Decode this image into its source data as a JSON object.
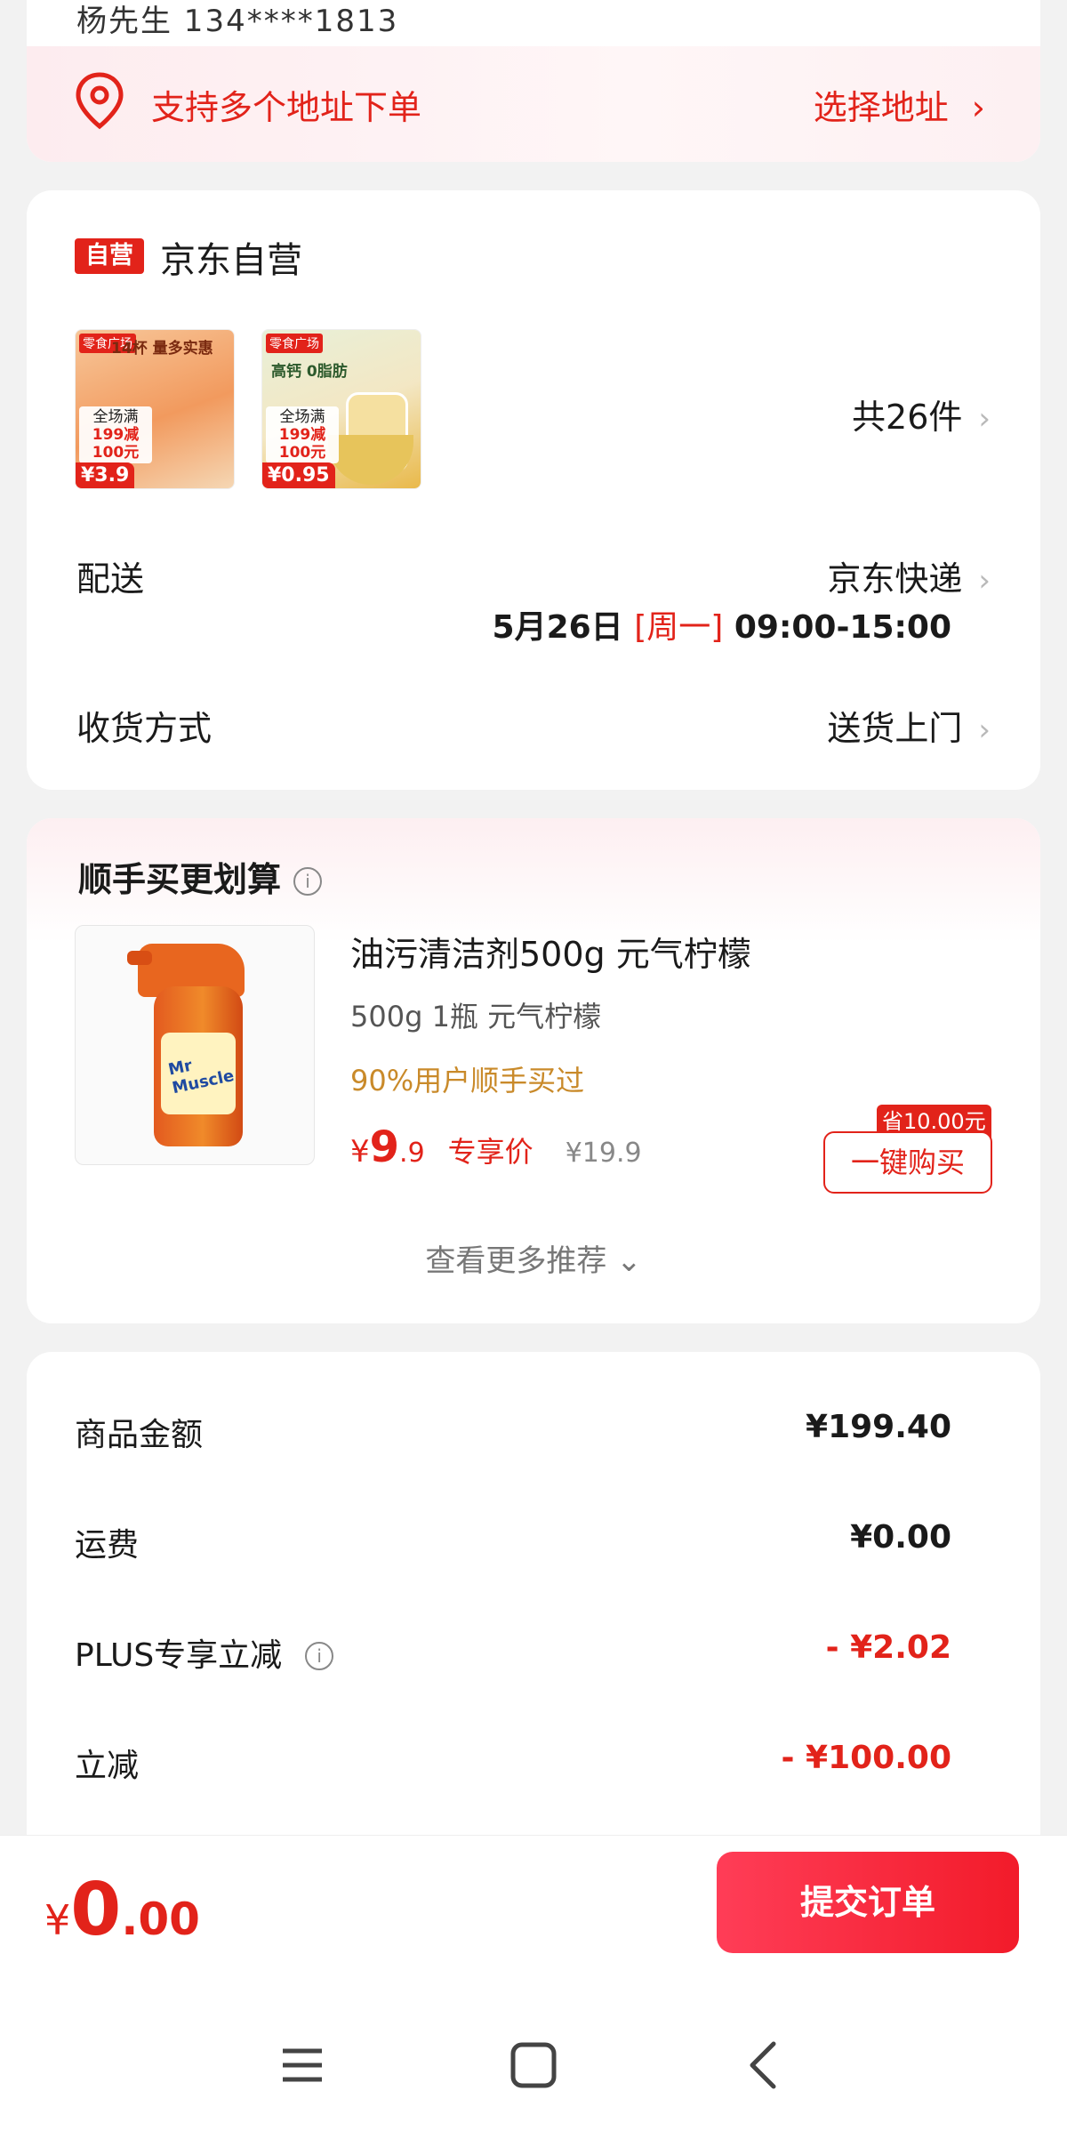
{
  "address": {
    "peek_text": "杨先生 134****1813",
    "multi_address": "支持多个地址下单",
    "choose_label": "选择地址",
    "chevron": "›"
  },
  "shop": {
    "badge": "自营",
    "name": "京东自营",
    "thumbnails": [
      {
        "tag": "零食广场",
        "headline": "14杯 量多实惠",
        "promo_top": "全场满",
        "promo_mid": "199减",
        "promo_bot": "100元",
        "price": "¥3.9"
      },
      {
        "tag": "零食广场",
        "headline": "高钙 0脂肪",
        "promo_top": "全场满",
        "promo_mid": "199减",
        "promo_bot": "100元",
        "price": "¥0.95"
      }
    ],
    "item_count": "共26件",
    "delivery_label": "配送",
    "delivery_value": "京东快递",
    "delivery_date": "5月26日",
    "delivery_weekday": "[周一]",
    "delivery_time": "09:00-15:00",
    "receive_label": "收货方式",
    "receive_value": "送货上门"
  },
  "recommend": {
    "title": "顺手买更划算",
    "info_icon": "i",
    "product": {
      "name": "油污清洁剂500g 元气柠檬",
      "spec": "500g 1瓶 元气柠檬",
      "buyers": "90%用户顺手买过",
      "currency": "¥",
      "price_int": "9",
      "price_dec": ".9",
      "exclusive": "专享价",
      "orig_price": "¥19.9",
      "save_badge": "省10.00元",
      "buy_label": "一键购买",
      "bottle_text": "Mr Muscle"
    },
    "more_label": "查看更多推荐 ⌄"
  },
  "price": {
    "rows": [
      {
        "label": "商品金额",
        "value": "¥199.40"
      },
      {
        "label": "运费",
        "value": "¥0.00"
      },
      {
        "label": "PLUS专享立减",
        "value": "- ¥2.02"
      },
      {
        "label": "立减",
        "value": "- ¥100.00"
      }
    ]
  },
  "bottom": {
    "currency": "¥",
    "total_int": "0",
    "total_dec": ".00",
    "submit_label": "提交订单"
  },
  "colors": {
    "accent": "#e2231a",
    "background": "#f2f2f2"
  },
  "icons": [
    "location-pin-icon",
    "info-icon",
    "chevron-right-icon",
    "menu-icon",
    "home-icon",
    "back-icon"
  ]
}
